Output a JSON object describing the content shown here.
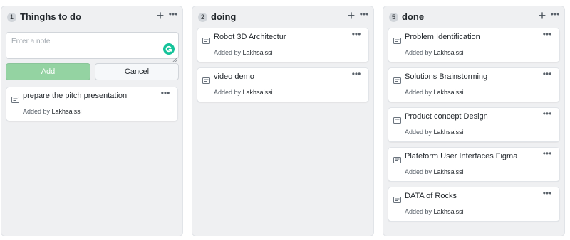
{
  "columns": [
    {
      "count": "1",
      "title": "Thinghs to do",
      "add_icon": "plus-icon",
      "menu_icon": "ellipsis-icon",
      "note_input": {
        "value": "",
        "placeholder": "Enter a note"
      },
      "add_button": "Add",
      "cancel_button": "Cancel",
      "cards": [
        {
          "title": "prepare the pitch presentation",
          "added_by": "Added by",
          "author": "Lakhsaissi"
        }
      ]
    },
    {
      "count": "2",
      "title": "doing",
      "add_icon": "plus-icon",
      "menu_icon": "ellipsis-icon",
      "cards": [
        {
          "title": "Robot 3D Architectur",
          "added_by": "Added by",
          "author": "Lakhsaissi"
        },
        {
          "title": "video demo",
          "added_by": "Added by",
          "author": "Lakhsaissi"
        }
      ]
    },
    {
      "count": "5",
      "title": "done",
      "add_icon": "plus-icon",
      "menu_icon": "ellipsis-icon",
      "cards": [
        {
          "title": "Problem Identification",
          "added_by": "Added by",
          "author": "Lakhsaissi"
        },
        {
          "title": "Solutions Brainstorming",
          "added_by": "Added by",
          "author": "Lakhsaissi"
        },
        {
          "title": "Product concept Design",
          "added_by": "Added by",
          "author": "Lakhsaissi"
        },
        {
          "title": "Plateform User Interfaces Figma",
          "added_by": "Added by",
          "author": "Lakhsaissi"
        },
        {
          "title": "DATA of Rocks",
          "added_by": "Added by",
          "author": "Lakhsaissi"
        }
      ]
    }
  ],
  "colors": {
    "column_bg": "#eff0f2",
    "add_button_bg": "#94d3a2",
    "grammarly": "#15c39a"
  }
}
